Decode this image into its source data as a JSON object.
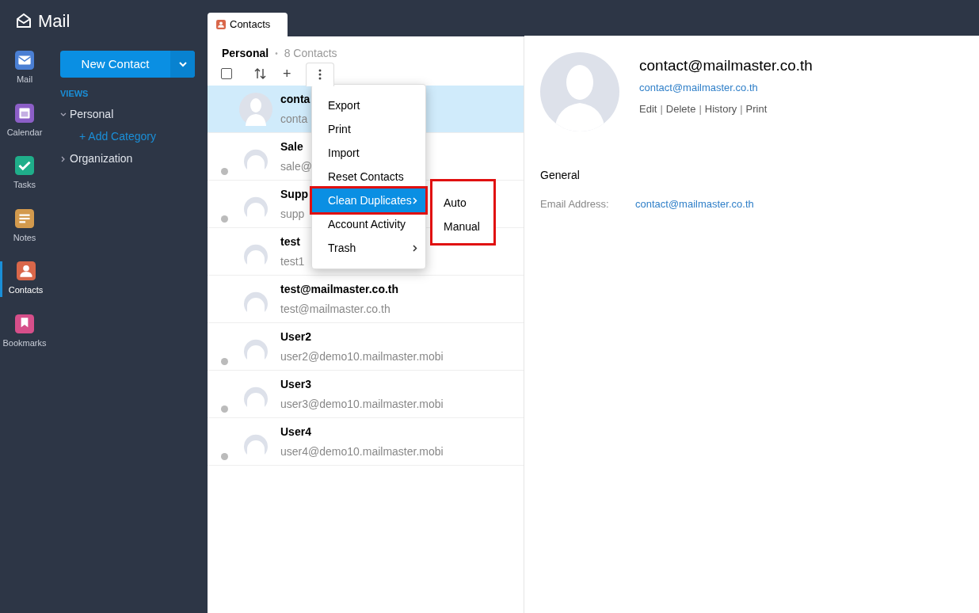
{
  "app": {
    "title": "Mail"
  },
  "rail": [
    {
      "label": "Mail",
      "color": "#4a7fd4",
      "kind": "mail",
      "selected": false
    },
    {
      "label": "Calendar",
      "color": "#8c5fc7",
      "kind": "calendar",
      "selected": false
    },
    {
      "label": "Tasks",
      "color": "#1fae8a",
      "kind": "tasks",
      "selected": false
    },
    {
      "label": "Notes",
      "color": "#d39a4d",
      "kind": "notes",
      "selected": false
    },
    {
      "label": "Contacts",
      "color": "#d9674a",
      "kind": "contacts",
      "selected": true
    },
    {
      "label": "Bookmarks",
      "color": "#d64f8a",
      "kind": "bookmarks",
      "selected": false
    }
  ],
  "sidebar": {
    "new_button": "New Contact",
    "views_heading": "VIEWS",
    "tree": [
      {
        "label": "Personal",
        "expanded": true,
        "children": [
          {
            "label": "+ Add Category"
          }
        ]
      },
      {
        "label": "Organization",
        "expanded": false
      }
    ]
  },
  "tabs": [
    {
      "label": "Contacts",
      "selected": true
    }
  ],
  "list_header": {
    "title": "Personal",
    "separator": "•",
    "count": "8 Contacts"
  },
  "toolbar": {
    "select_all_checked": false,
    "add": "+",
    "more_open": true
  },
  "contacts": [
    {
      "name": "conta",
      "email": "conta",
      "selected": true,
      "status_dot": false
    },
    {
      "name": "Sale",
      "email": "sale@",
      "selected": false,
      "status_dot": true
    },
    {
      "name": "Supp",
      "email": "supp",
      "selected": false,
      "status_dot": true
    },
    {
      "name": "test",
      "email": "test1",
      "selected": false,
      "status_dot": false
    },
    {
      "name": "test@mailmaster.co.th",
      "email": "test@mailmaster.co.th",
      "selected": false,
      "status_dot": false
    },
    {
      "name": "User2",
      "email": "user2@demo10.mailmaster.mobi",
      "selected": false,
      "status_dot": true
    },
    {
      "name": "User3",
      "email": "user3@demo10.mailmaster.mobi",
      "selected": false,
      "status_dot": true
    },
    {
      "name": "User4",
      "email": "user4@demo10.mailmaster.mobi",
      "selected": false,
      "status_dot": true
    }
  ],
  "menu": [
    {
      "label": "Export",
      "selected": false,
      "submenu": false,
      "highlighted": false
    },
    {
      "label": "Print",
      "selected": false,
      "submenu": false,
      "highlighted": false
    },
    {
      "label": "Import",
      "selected": false,
      "submenu": false,
      "highlighted": false
    },
    {
      "label": "Reset Contacts",
      "selected": false,
      "submenu": false,
      "highlighted": false
    },
    {
      "label": "Clean Duplicates",
      "selected": true,
      "submenu": true,
      "highlighted": true
    },
    {
      "label": "Account Activity",
      "selected": false,
      "submenu": false,
      "highlighted": false
    },
    {
      "label": "Trash",
      "selected": false,
      "submenu": true,
      "highlighted": false
    }
  ],
  "submenu": {
    "highlighted": true,
    "items": [
      "Auto",
      "Manual"
    ]
  },
  "detail": {
    "name": "contact@mailmaster.co.th",
    "email": "contact@mailmaster.co.th",
    "actions": [
      "Edit",
      "|",
      "Delete",
      "|",
      "History",
      "|",
      "Print"
    ],
    "section": "General",
    "fields": [
      {
        "label": "Email Address:",
        "value": "contact@mailmaster.co.th"
      }
    ]
  }
}
